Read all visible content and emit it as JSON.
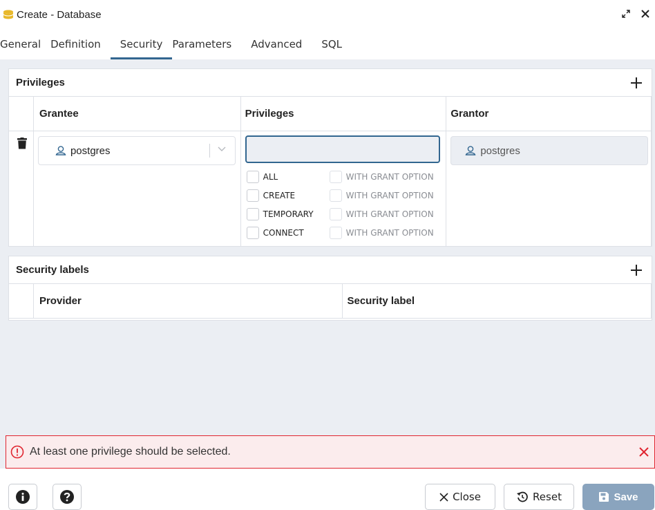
{
  "window": {
    "title": "Create - Database",
    "icons": {
      "title": "database-icon",
      "expand": "expand-icon",
      "close": "close-icon"
    }
  },
  "tabs": [
    {
      "label": "General"
    },
    {
      "label": "Definition"
    },
    {
      "label": "Security",
      "active": true
    },
    {
      "label": "Parameters"
    },
    {
      "label": "Advanced"
    },
    {
      "label": "SQL"
    }
  ],
  "privileges": {
    "title": "Privileges",
    "columns": {
      "grantee": "Grantee",
      "privileges": "Privileges",
      "grantor": "Grantor"
    },
    "row": {
      "grantee": "postgres",
      "grantor": "postgres",
      "privilege_input_value": "",
      "options": [
        {
          "label": "ALL",
          "grant_label": "WITH GRANT OPTION"
        },
        {
          "label": "CREATE",
          "grant_label": "WITH GRANT OPTION"
        },
        {
          "label": "TEMPORARY",
          "grant_label": "WITH GRANT OPTION"
        },
        {
          "label": "CONNECT",
          "grant_label": "WITH GRANT OPTION"
        }
      ]
    }
  },
  "security_labels": {
    "title": "Security labels",
    "columns": {
      "provider": "Provider",
      "security_label": "Security label"
    }
  },
  "error": {
    "message": "At least one privilege should be selected."
  },
  "footer": {
    "close": "Close",
    "reset": "Reset",
    "save": "Save"
  },
  "colors": {
    "accent": "#326690",
    "error": "#e0242f",
    "db_icon": "#e8b82a",
    "save_bg": "#8aa4be"
  }
}
